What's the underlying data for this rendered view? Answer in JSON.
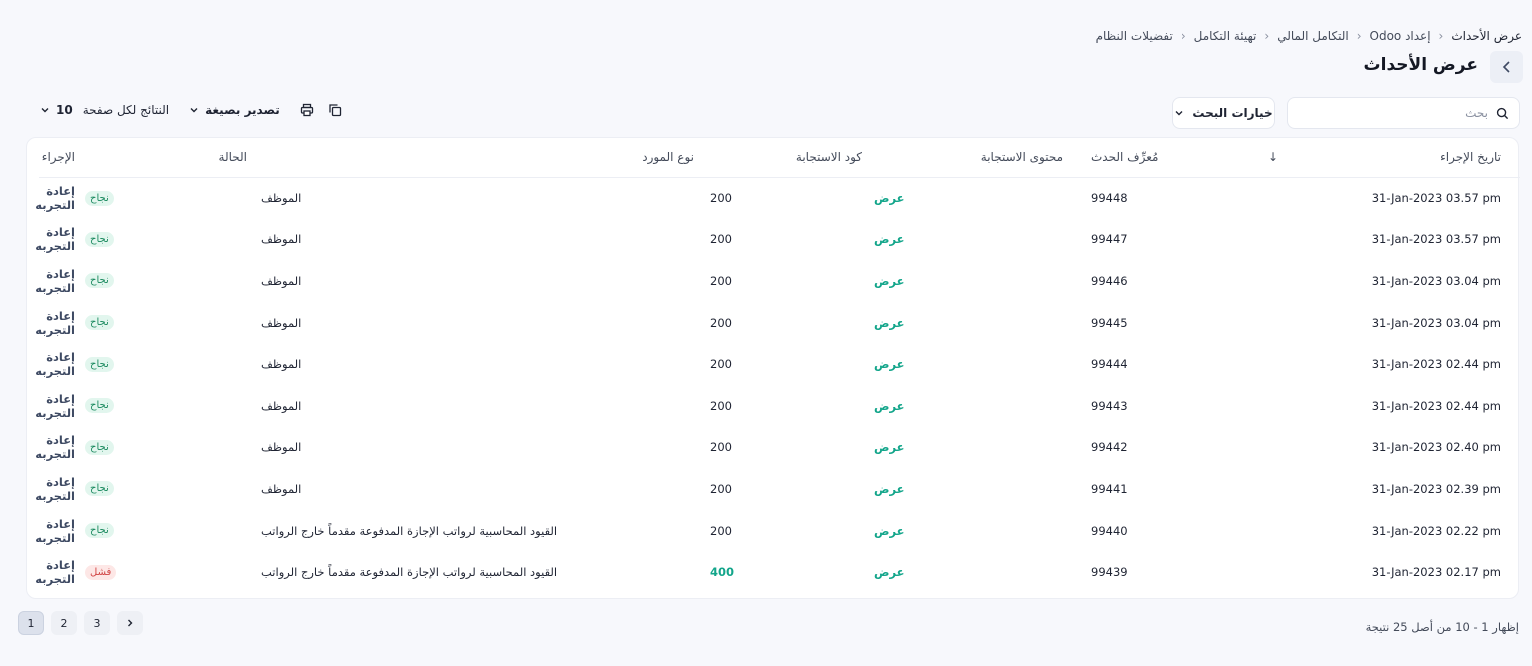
{
  "breadcrumb": {
    "items": [
      "تفضيلات النظام",
      "تهيئة التكامل",
      "التكامل المالي",
      "إعداد Odoo",
      "عرض الأحداث"
    ]
  },
  "page": {
    "title": "عرض الأحداث"
  },
  "search": {
    "placeholder": "بحث",
    "options_label": "خيارات البحث"
  },
  "toolbar": {
    "export_label": "تصدير بصيغة",
    "per_page_label": "النتائج لكل صفحة",
    "per_page_value": "10"
  },
  "table": {
    "columns": {
      "date": "تاريخ الإجراء",
      "event_id": "مُعرِّف الحدث",
      "content": "محتوى الاستجابة",
      "code": "كود الاستجابة",
      "vendor": "نوع المورد",
      "status": "الحالة",
      "action": "الإجراء"
    },
    "rows": [
      {
        "date": "31-Jan-2023 03.57 pm",
        "id": "99448",
        "content": "عرض",
        "code": "200",
        "vendor": "الموظف",
        "status": "نجاح",
        "status_type": "success",
        "action": "إعادة التجربه"
      },
      {
        "date": "31-Jan-2023 03.57 pm",
        "id": "99447",
        "content": "عرض",
        "code": "200",
        "vendor": "الموظف",
        "status": "نجاح",
        "status_type": "success",
        "action": "إعادة التجربه"
      },
      {
        "date": "31-Jan-2023 03.04 pm",
        "id": "99446",
        "content": "عرض",
        "code": "200",
        "vendor": "الموظف",
        "status": "نجاح",
        "status_type": "success",
        "action": "إعادة التجربه"
      },
      {
        "date": "31-Jan-2023 03.04 pm",
        "id": "99445",
        "content": "عرض",
        "code": "200",
        "vendor": "الموظف",
        "status": "نجاح",
        "status_type": "success",
        "action": "إعادة التجربه"
      },
      {
        "date": "31-Jan-2023 02.44 pm",
        "id": "99444",
        "content": "عرض",
        "code": "200",
        "vendor": "الموظف",
        "status": "نجاح",
        "status_type": "success",
        "action": "إعادة التجربه"
      },
      {
        "date": "31-Jan-2023 02.44 pm",
        "id": "99443",
        "content": "عرض",
        "code": "200",
        "vendor": "الموظف",
        "status": "نجاح",
        "status_type": "success",
        "action": "إعادة التجربه"
      },
      {
        "date": "31-Jan-2023 02.40 pm",
        "id": "99442",
        "content": "عرض",
        "code": "200",
        "vendor": "الموظف",
        "status": "نجاح",
        "status_type": "success",
        "action": "إعادة التجربه"
      },
      {
        "date": "31-Jan-2023 02.39 pm",
        "id": "99441",
        "content": "عرض",
        "code": "200",
        "vendor": "الموظف",
        "status": "نجاح",
        "status_type": "success",
        "action": "إعادة التجربه"
      },
      {
        "date": "31-Jan-2023 02.22 pm",
        "id": "99440",
        "content": "عرض",
        "code": "200",
        "vendor": "القيود المحاسبية لرواتب الإجازة المدفوعة مقدماً خارج الرواتب",
        "status": "نجاح",
        "status_type": "success",
        "action": "إعادة التجربه"
      },
      {
        "date": "31-Jan-2023 02.17 pm",
        "id": "99439",
        "content": "عرض",
        "code": "400",
        "vendor": "القيود المحاسبية لرواتب الإجازة المدفوعة مقدماً خارج الرواتب",
        "status": "فشل",
        "status_type": "fail",
        "action": "إعادة التجربه"
      }
    ]
  },
  "pagination": {
    "pages": [
      "1",
      "2",
      "3"
    ],
    "current": "1"
  },
  "summary": "إظهار 1 - 10 من أصل 25 نتيجة",
  "colors": {
    "accent": "#12a58a",
    "success_bg": "#e2f6ee",
    "fail_bg": "#fde7e6"
  }
}
